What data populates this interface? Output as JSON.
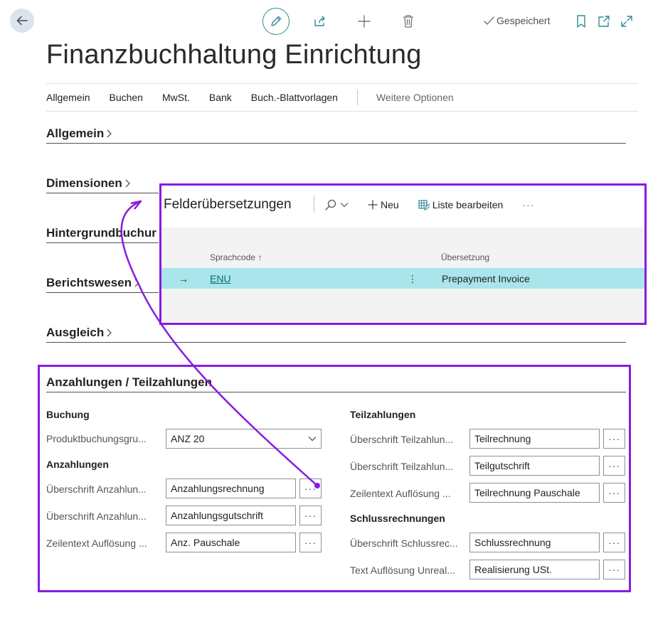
{
  "toolbar": {
    "saved_label": "Gespeichert"
  },
  "page": {
    "title": "Finanzbuchhaltung Einrichtung"
  },
  "actions": {
    "items": [
      "Allgemein",
      "Buchen",
      "MwSt.",
      "Bank",
      "Buch.-Blattvorlagen"
    ],
    "more": "Weitere Optionen"
  },
  "sections": {
    "allgemein": "Allgemein",
    "dimensionen": "Dimensionen",
    "hintergrund": "Hintergrundbuchur",
    "berichtswesen": "Berichtswesen",
    "ausgleich": "Ausgleich",
    "anzahlungen": "Anzahlungen / Teilzahlungen"
  },
  "left": {
    "group_buchung": "Buchung",
    "produkt_label": "Produktbuchungsgru...",
    "produkt_value": "ANZ 20",
    "group_anzahlungen": "Anzahlungen",
    "fields": [
      {
        "label": "Überschrift Anzahlun...",
        "value": "Anzahlungsrechnung"
      },
      {
        "label": "Überschrift Anzahlun...",
        "value": "Anzahlungsgutschrift"
      },
      {
        "label": "Zeilentext Auflösung ...",
        "value": "Anz. Pauschale"
      }
    ]
  },
  "right": {
    "group_teilzahlungen": "Teilzahlungen",
    "teil_fields": [
      {
        "label": "Überschrift Teilzahlun...",
        "value": "Teilrechnung"
      },
      {
        "label": "Überschrift Teilzahlun...",
        "value": "Teilgutschrift"
      },
      {
        "label": "Zeilentext Auflösung ...",
        "value": "Teilrechnung Pauschale"
      }
    ],
    "group_schluss": "Schlussrechnungen",
    "schluss_fields": [
      {
        "label": "Überschrift Schlussrec...",
        "value": "Schlussrechnung"
      },
      {
        "label": "Text Auflösung Unreal...",
        "value": "Realisierung USt."
      }
    ]
  },
  "translations": {
    "title": "Felderübersetzungen",
    "new_label": "Neu",
    "edit_list_label": "Liste bearbeiten",
    "col_language": "Sprachcode",
    "col_translation": "Übersetzung",
    "rows": [
      {
        "language": "ENU",
        "translation": "Prepayment Invoice"
      }
    ]
  },
  "colors": {
    "accent": "#2c8b96",
    "highlight": "#8a1bdf",
    "row_selected": "#a9e5ea"
  }
}
